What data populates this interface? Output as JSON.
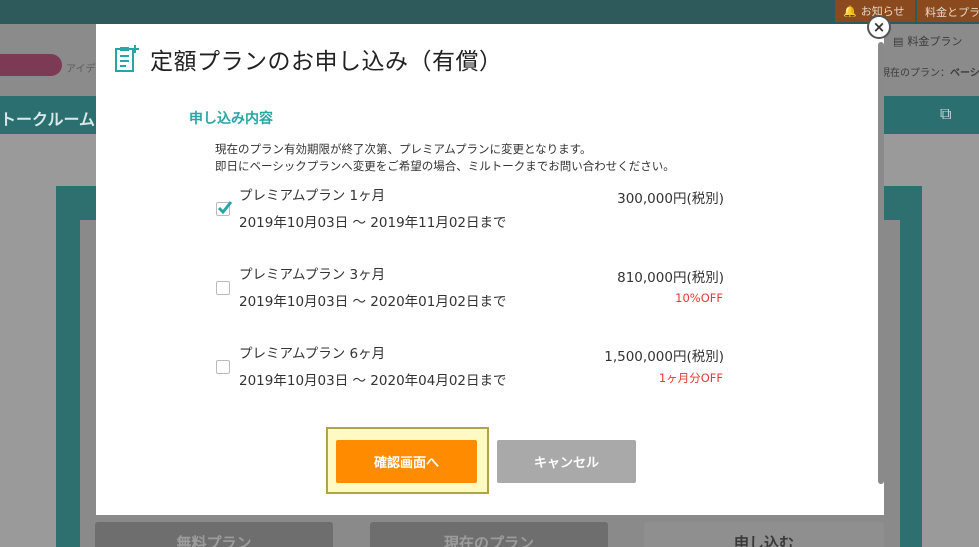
{
  "background": {
    "notice_label": "お知らせ",
    "plan_link_label": "料金とプラ",
    "ryokin_label": "料金プラン",
    "current_plan_label": "現在のプラン：",
    "current_plan_value": "ベーシッ",
    "logo_text": "アイデ",
    "talkroom_label": "トークルーム",
    "bottom_buttons": [
      "無料プラン",
      "現在のプラン",
      "申し込む"
    ]
  },
  "modal": {
    "title": "定額プランのお申し込み（有償）",
    "section_heading": "申し込み内容",
    "notice_lines": [
      "現在のプラン有効期限が終了次第、プレミアムプランに変更となります。",
      "即日にベーシックプランへ変更をご希望の場合、ミルトークまでお問い合わせください。"
    ],
    "plans": [
      {
        "name": "プレミアムプラン 1ヶ月",
        "period": "2019年10月03日 〜 2019年11月02日まで",
        "price": "300,000円(税別)",
        "discount": "",
        "checked": true
      },
      {
        "name": "プレミアムプラン 3ヶ月",
        "period": "2019年10月03日 〜 2020年01月02日まで",
        "price": "810,000円(税別)",
        "discount": "10%OFF",
        "checked": false
      },
      {
        "name": "プレミアムプラン 6ヶ月",
        "period": "2019年10月03日 〜 2020年04月02日まで",
        "price": "1,500,000円(税別)",
        "discount": "1ヶ月分OFF",
        "checked": false
      }
    ],
    "confirm_label": "確認画面へ",
    "cancel_label": "キャンセル",
    "close_symbol": "×"
  },
  "colors": {
    "accent_teal": "#2aa5a5",
    "confirm_orange": "#ff8c00",
    "cancel_gray": "#a9a9a9",
    "discount_red": "#e53935",
    "highlight_yellow": "#fff9c4"
  }
}
